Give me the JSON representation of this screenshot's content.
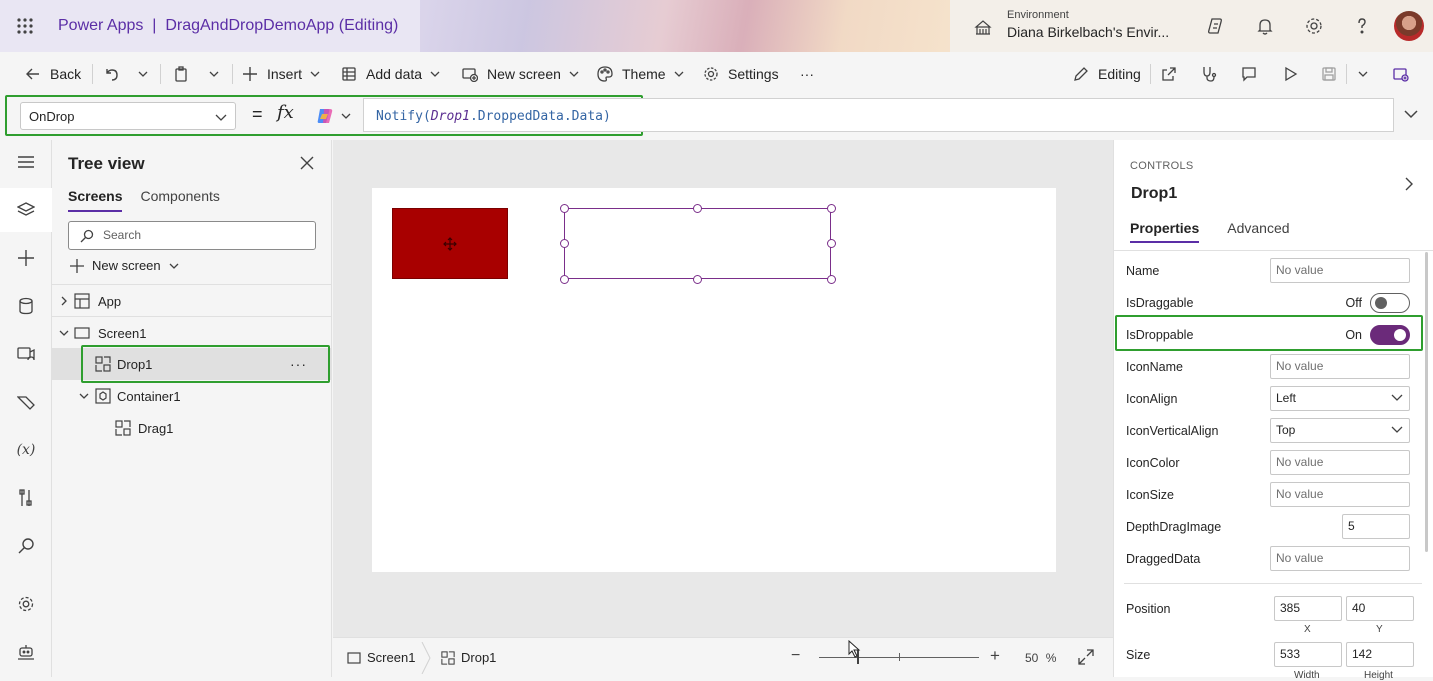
{
  "header": {
    "app_name": "Power Apps",
    "divider": "|",
    "app_title": "DragAndDropDemoApp (Editing)",
    "environment_label": "Environment",
    "environment_name": "Diana Birkelbach's Envir...",
    "icons": [
      "waffle-icon",
      "environment-icon",
      "copilot-icon",
      "bell-icon",
      "gear-icon",
      "help-icon",
      "avatar"
    ]
  },
  "command_bar": {
    "back": "Back",
    "insert": "Insert",
    "add_data": "Add data",
    "new_screen": "New screen",
    "theme": "Theme",
    "settings": "Settings",
    "more": "···",
    "editing": "Editing"
  },
  "formula_bar": {
    "property": "OnDrop",
    "equals": "=",
    "fx": "fx",
    "formula_fn": "Notify(",
    "formula_ctl": "Drop1",
    "formula_rest": ".DroppedData.Data)"
  },
  "tree_view": {
    "title": "Tree view",
    "tabs": [
      "Screens",
      "Components"
    ],
    "selected_tab": "Screens",
    "search_placeholder": "Search",
    "new_screen": "New screen",
    "items": [
      {
        "label": "App",
        "icon": "app-icon",
        "expanded": false
      },
      {
        "label": "Screen1",
        "icon": "screen-icon",
        "expanded": true
      },
      {
        "label": "Drop1",
        "icon": "drop-control-icon",
        "selected": true,
        "more": "···"
      },
      {
        "label": "Container1",
        "icon": "container-icon",
        "expanded": true
      },
      {
        "label": "Drag1",
        "icon": "drag-control-icon"
      }
    ]
  },
  "status_bar": {
    "screen": "Screen1",
    "control": "Drop1",
    "zoom_minus": "−",
    "zoom_plus": "+",
    "zoom_value": "50",
    "zoom_unit": "%"
  },
  "properties": {
    "section": "CONTROLS",
    "control_name": "Drop1",
    "tabs": [
      "Properties",
      "Advanced"
    ],
    "selected_tab": "Properties",
    "rows": {
      "name": {
        "label": "Name",
        "placeholder": "No value"
      },
      "is_draggable": {
        "label": "IsDraggable",
        "state": "Off",
        "on": false
      },
      "is_droppable": {
        "label": "IsDroppable",
        "state": "On",
        "on": true
      },
      "icon_name": {
        "label": "IconName",
        "placeholder": "No value"
      },
      "icon_align": {
        "label": "IconAlign",
        "value": "Left"
      },
      "icon_vertical_align": {
        "label": "IconVerticalAlign",
        "value": "Top"
      },
      "icon_color": {
        "label": "IconColor",
        "placeholder": "No value"
      },
      "icon_size": {
        "label": "IconSize",
        "placeholder": "No value"
      },
      "depth_drag_image": {
        "label": "DepthDragImage",
        "value": "5"
      },
      "dragged_data": {
        "label": "DraggedData",
        "placeholder": "No value"
      }
    },
    "position": {
      "label": "Position",
      "x": "385",
      "y": "40",
      "x_label": "X",
      "y_label": "Y"
    },
    "size": {
      "label": "Size",
      "width": "533",
      "height": "142",
      "width_label": "Width",
      "height_label": "Height"
    }
  },
  "colors": {
    "accent": "#5b2ea6",
    "toggle_on": "#6b2a7a",
    "highlight": "#2f9e2f",
    "drag_control": "#a80000"
  }
}
